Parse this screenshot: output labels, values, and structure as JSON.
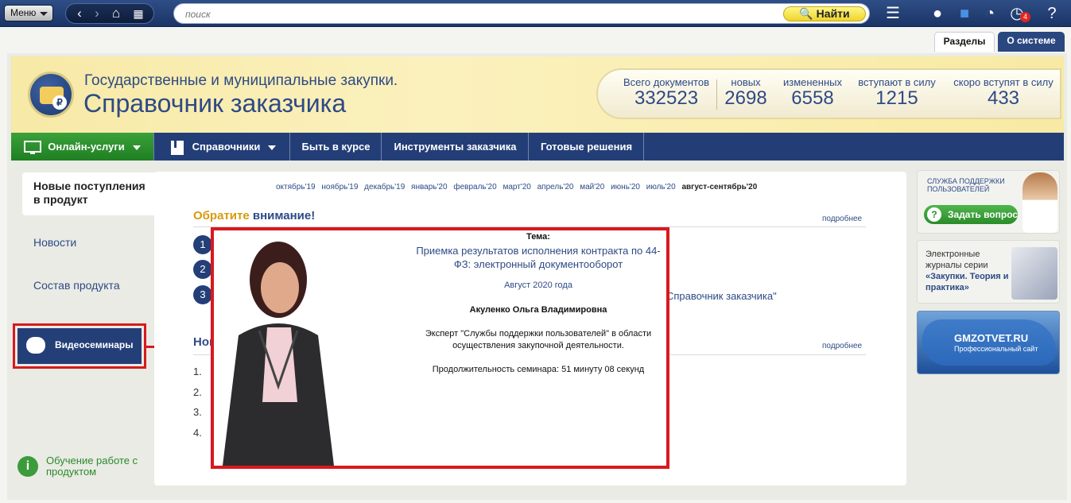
{
  "toolbar": {
    "menu_label": "Меню",
    "search_placeholder": "поиск",
    "find_label": "Найти",
    "notifications_count": "4"
  },
  "tabs": {
    "sections": "Разделы",
    "about": "О системе"
  },
  "brand": {
    "subtitle": "Государственные и муниципальные закупки.",
    "title": "Справочник заказчика"
  },
  "stats": [
    {
      "label": "Всего документов",
      "value": "332523"
    },
    {
      "label": "новых",
      "value": "2698"
    },
    {
      "label": "измененных",
      "value": "6558"
    },
    {
      "label": "вступают в силу",
      "value": "1215"
    },
    {
      "label": "скоро вступят в силу",
      "value": "433"
    }
  ],
  "nav": {
    "online": "Онлайн-услуги",
    "reference": "Справочники",
    "course": "Быть в курсе",
    "tools": "Инструменты заказчика",
    "solutions": "Готовые решения"
  },
  "sidebar": {
    "active": "Новые поступления в продукт",
    "news": "Новости",
    "contents": "Состав продукта",
    "video": "Видеосеминары",
    "learn": "Обучение работе с продуктом"
  },
  "months": [
    "октябрь'19",
    "ноябрь'19",
    "декабрь'19",
    "январь'20",
    "февраль'20",
    "март'20",
    "апрель'20",
    "май'20",
    "июнь'20",
    "июль'20",
    "август-сентябрь'20"
  ],
  "attention": {
    "prefix": "Обратите",
    "rest": " внимание!",
    "more": "подробнее"
  },
  "news_block": {
    "title_fragment": "Нов",
    "more": "подробнее"
  },
  "fragment_text": "Справочник заказчика\"",
  "popup": {
    "theme_label": "Тема:",
    "title": "Приемка результатов исполнения контракта по 44-ФЗ: электронный документооборот",
    "date": "Август 2020 года",
    "author": "Акуленко Ольга Владимировна",
    "description": "Эксперт \"Службы поддержки пользователей\" в области осуществления закупочной деятельности.",
    "duration": "Продолжительность семинара:  51 минуту 08 секунд"
  },
  "promos": {
    "support": "СЛУЖБА ПОДДЕРЖКИ ПОЛЬЗОВАТЕЛЕЙ",
    "ask": "Задать вопрос",
    "journals": "Электронные журналы серии",
    "journals_name": "«Закупки. Теория и практика»",
    "site": "GMZOTVET.RU",
    "site_sub": "Профессиональный сайт"
  }
}
